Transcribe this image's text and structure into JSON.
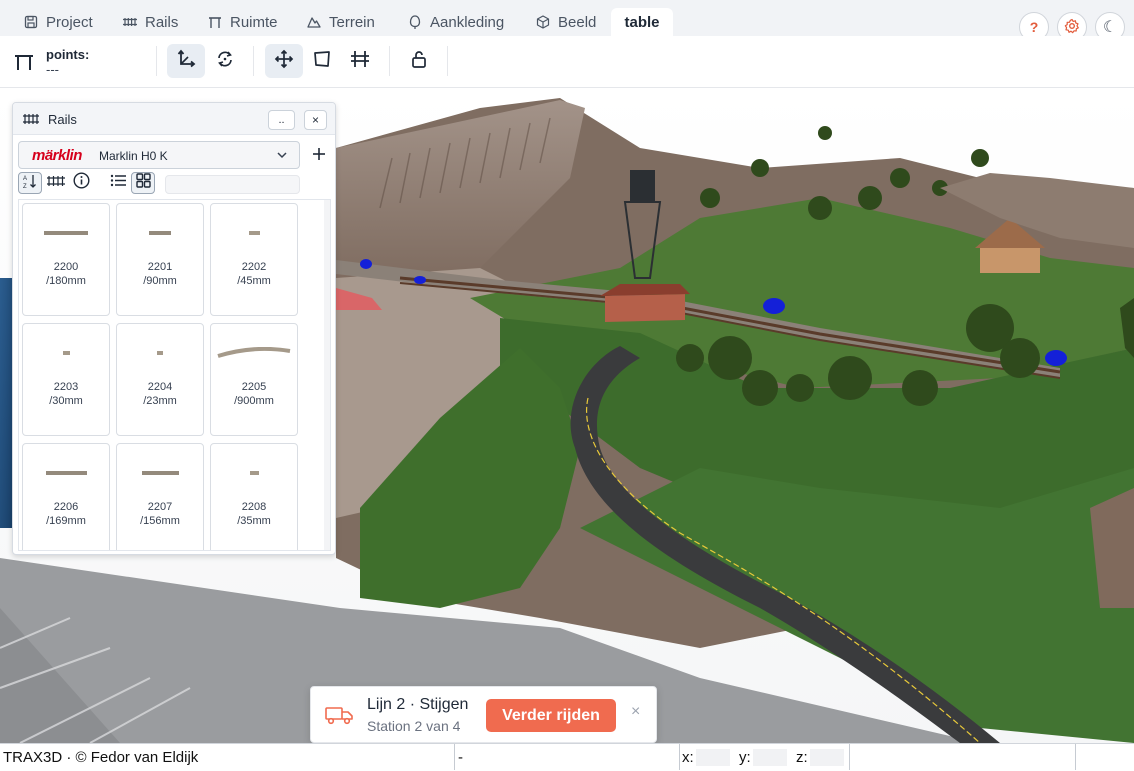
{
  "tabs": [
    {
      "label": "Project",
      "icon": "save-icon",
      "active": false
    },
    {
      "label": "Rails",
      "icon": "rails-icon",
      "active": false
    },
    {
      "label": "Ruimte",
      "icon": "table-icon",
      "active": false
    },
    {
      "label": "Terrein",
      "icon": "mountain-icon",
      "active": false
    },
    {
      "label": "Aankleding",
      "icon": "tree-icon",
      "active": false
    },
    {
      "label": "Beeld",
      "icon": "cube-icon",
      "active": false
    },
    {
      "label": "table",
      "icon": "",
      "active": true
    }
  ],
  "header_buttons": {
    "help": "?",
    "settings_icon": "gear-icon",
    "theme_icon": "moon-icon",
    "theme": "☾"
  },
  "toolbar": {
    "points_label": "points:",
    "points_value": "---"
  },
  "rails_panel": {
    "title": "Rails",
    "more_label": "..",
    "close_label": "×",
    "brand_logo": "märklin",
    "brand_name": "Marklin H0 K",
    "filter_placeholder": "",
    "filter_value": "",
    "items": [
      {
        "number": "2200",
        "length": "/180mm"
      },
      {
        "number": "2201",
        "length": "/90mm"
      },
      {
        "number": "2202",
        "length": "/45mm"
      },
      {
        "number": "2203",
        "length": "/30mm"
      },
      {
        "number": "2204",
        "length": "/23mm"
      },
      {
        "number": "2205",
        "length": "/900mm"
      },
      {
        "number": "2206",
        "length": "/169mm"
      },
      {
        "number": "2207",
        "length": "/156mm"
      },
      {
        "number": "2208",
        "length": "/35mm"
      }
    ]
  },
  "notification": {
    "title": "Lijn 2 · Stijgen",
    "subtitle": "Station 2 van 4",
    "action_label": "Verder rijden",
    "close_label": "×"
  },
  "statusbar": {
    "credit": "TRAX3D · © Fedor van Eldijk",
    "status": "-",
    "x_label": "x:",
    "y_label": "y:",
    "z_label": "z:"
  },
  "colors": {
    "accent": "#f06b4f",
    "brand_red": "#d6001c"
  }
}
